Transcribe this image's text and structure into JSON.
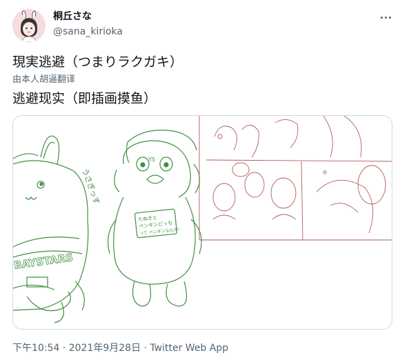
{
  "author": {
    "display_name": "桐丘さな",
    "handle": "@sana_kirioka"
  },
  "tweet": {
    "text": "現実逃避（つまりラクガキ）",
    "translated_by": "由本人胡逼翻译",
    "translation": "逃避现实（即插画摸鱼）"
  },
  "media": {
    "panel_left_scribbles": [
      "うさぎっす",
      "YS",
      "BAYSTARS"
    ],
    "sign_text": [
      "たぬきと",
      "ペンギンどっち",
      "って ペンギンなんか!"
    ],
    "icon": "image-icon"
  },
  "meta": {
    "time": "下午10:54",
    "separator": " · ",
    "date": "2021年9月28日",
    "source": "Twitter Web App"
  },
  "colors": {
    "sketch_green": "#3f8f3f",
    "sketch_red": "#b35a5a",
    "secondary_text": "#536471",
    "border": "#cfd9de"
  }
}
